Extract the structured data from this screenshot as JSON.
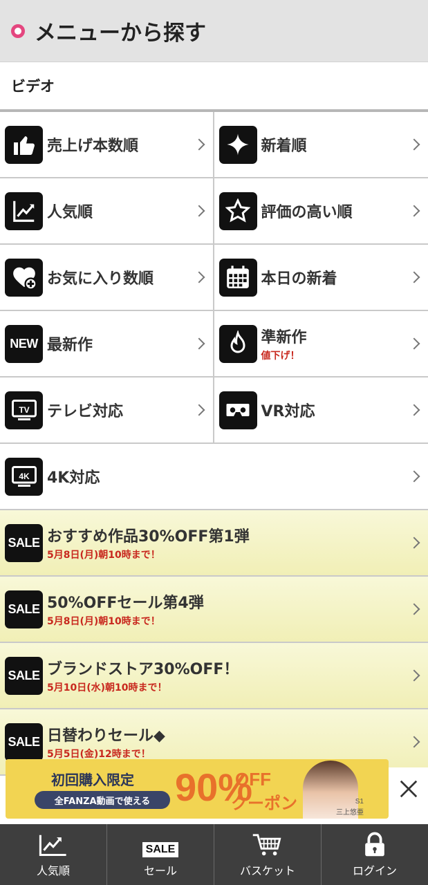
{
  "header": {
    "title": "メニューから探す"
  },
  "section": {
    "title": "ビデオ"
  },
  "menu": [
    {
      "label": "売上げ本数順",
      "icon": "thumbs-up-icon"
    },
    {
      "label": "新着順",
      "icon": "sparkle-icon"
    },
    {
      "label": "人気順",
      "icon": "trending-chart-icon"
    },
    {
      "label": "評価の高い順",
      "icon": "star-icon"
    },
    {
      "label": "お気に入り数順",
      "icon": "heart-plus-icon"
    },
    {
      "label": "本日の新着",
      "icon": "calendar-icon"
    },
    {
      "label": "最新作",
      "icon": "new-badge-icon",
      "icon_text": "NEW"
    },
    {
      "label": "準新作",
      "sub": "値下げ！",
      "icon": "flame-icon"
    },
    {
      "label": "テレビ対応",
      "icon": "tv-icon",
      "icon_text": "TV"
    },
    {
      "label": "VR対応",
      "icon": "vr-goggles-icon"
    },
    {
      "label": "4K対応",
      "icon": "4k-display-icon",
      "icon_text": "4K"
    }
  ],
  "sales": [
    {
      "badge": "SALE",
      "label": "おすすめ作品30%OFF第1弾",
      "sub": "5月8日(月)朝10時まで！"
    },
    {
      "badge": "SALE",
      "label": "50%OFFセール第4弾",
      "sub": "5月8日(月)朝10時まで！"
    },
    {
      "badge": "SALE",
      "label": "ブランドストア30%OFF！",
      "sub": "5月10日(水)朝10時まで！"
    },
    {
      "badge": "SALE",
      "label": "日替わりセール◆",
      "sub": "5月5日(金)12時まで！"
    }
  ],
  "banner": {
    "line1": "初回購入限定",
    "line2": "全FANZA動画で使える",
    "percent": "90%",
    "off": "OFF",
    "coupon": "クーポン",
    "studio": "S1",
    "name": "三上悠亜"
  },
  "tabbar": [
    {
      "label": "人気順",
      "icon": "trending-chart-icon"
    },
    {
      "label": "セール",
      "icon": "sale-tag-icon",
      "icon_text": "SALE"
    },
    {
      "label": "バスケット",
      "icon": "cart-icon"
    },
    {
      "label": "ログイン",
      "icon": "lock-icon"
    }
  ],
  "colors": {
    "accent": "#e4467f",
    "sale_deadline": "#c8281e",
    "tabbar": "#3e3e3e",
    "sale_bg": "#f4f2c4"
  }
}
